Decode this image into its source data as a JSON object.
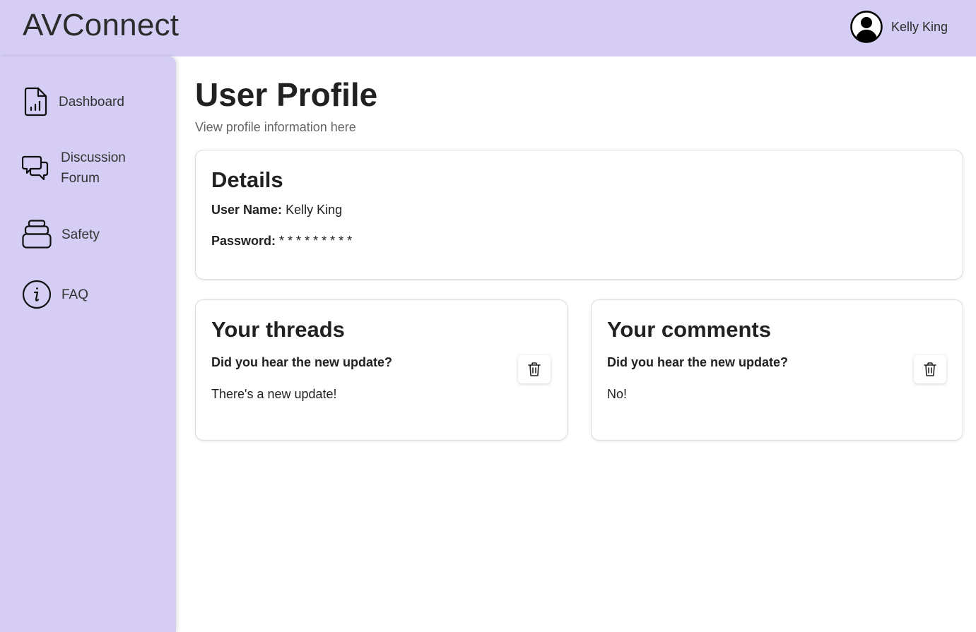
{
  "header": {
    "brand": "AVConnect",
    "user_name": "Kelly King",
    "user_icon": "user-circle-icon"
  },
  "sidebar": {
    "items": [
      {
        "label": "Dashboard",
        "icon": "document-chart-icon"
      },
      {
        "label": "Discussion Forum",
        "icon": "chat-bubbles-icon"
      },
      {
        "label": "Safety",
        "icon": "stack-box-icon"
      },
      {
        "label": "FAQ",
        "icon": "info-circle-icon"
      }
    ]
  },
  "page": {
    "title": "User Profile",
    "subtitle": "View profile information here"
  },
  "details": {
    "title": "Details",
    "user_name_label": "User Name:",
    "user_name_value": "Kelly King",
    "password_label": "Password:",
    "password_value": "* * * * * * * * *"
  },
  "threads": {
    "title": "Your threads",
    "items": [
      {
        "title": "Did you hear the new update?",
        "body": "There's a new update!"
      }
    ]
  },
  "comments": {
    "title": "Your comments",
    "items": [
      {
        "title": "Did you hear the new update?",
        "body": "No!"
      }
    ]
  },
  "colors": {
    "accent": "#d5cdf4",
    "text": "#212121"
  }
}
